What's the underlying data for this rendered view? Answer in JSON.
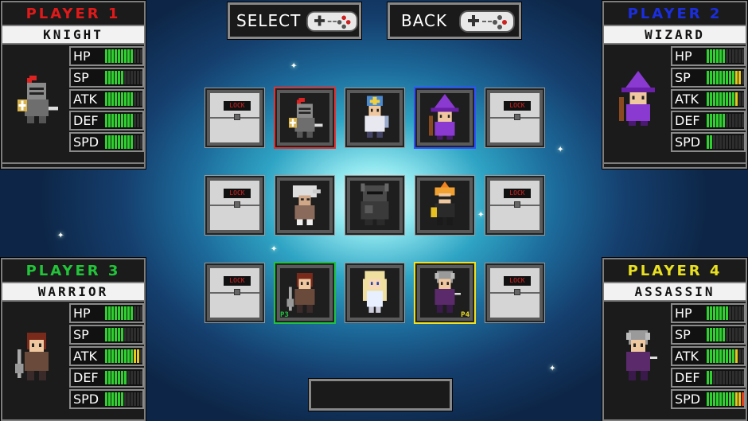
{
  "players": [
    {
      "title": "PLAYER 1",
      "title_color": "#e01a1a",
      "class_name": "KNIGHT",
      "icon": "knight-icon",
      "stats": [
        {
          "label": "HP",
          "value": 9,
          "max": 12
        },
        {
          "label": "SP",
          "value": 6,
          "max": 12
        },
        {
          "label": "ATK",
          "value": 9,
          "max": 12
        },
        {
          "label": "DEF",
          "value": 9,
          "max": 12
        },
        {
          "label": "SPD",
          "value": 9,
          "max": 12
        }
      ]
    },
    {
      "title": "PLAYER 2",
      "title_color": "#1a2ee0",
      "class_name": "WIZARD",
      "icon": "wizard-icon",
      "stats": [
        {
          "label": "HP",
          "value": 6,
          "max": 12
        },
        {
          "label": "SP",
          "value": 11,
          "max": 12
        },
        {
          "label": "ATK",
          "value": 10,
          "max": 12
        },
        {
          "label": "DEF",
          "value": 6,
          "max": 12
        },
        {
          "label": "SPD",
          "value": 2,
          "max": 12
        }
      ]
    },
    {
      "title": "PLAYER 3",
      "title_color": "#22c43a",
      "class_name": "WARRIOR",
      "icon": "warrior-icon",
      "stats": [
        {
          "label": "HP",
          "value": 9,
          "max": 12
        },
        {
          "label": "SP",
          "value": 6,
          "max": 12
        },
        {
          "label": "ATK",
          "value": 11,
          "max": 12
        },
        {
          "label": "DEF",
          "value": 7,
          "max": 12
        },
        {
          "label": "SPD",
          "value": 6,
          "max": 12
        }
      ]
    },
    {
      "title": "PLAYER 4",
      "title_color": "#e8e020",
      "class_name": "ASSASSIN",
      "icon": "assassin-icon",
      "stats": [
        {
          "label": "HP",
          "value": 7,
          "max": 12
        },
        {
          "label": "SP",
          "value": 6,
          "max": 12
        },
        {
          "label": "ATK",
          "value": 10,
          "max": 12
        },
        {
          "label": "DEF",
          "value": 2,
          "max": 12
        },
        {
          "label": "SPD",
          "value": 12,
          "max": 12
        }
      ]
    }
  ],
  "buttons": {
    "select": "SELECT",
    "back": "BACK"
  },
  "lock_label": "LOCK",
  "roster": [
    {
      "icon": "knight-icon",
      "selected_by": "P1"
    },
    {
      "icon": "cleric-icon",
      "selected_by": ""
    },
    {
      "icon": "wizard-icon",
      "selected_by": "P2"
    },
    {
      "icon": "hooded-fighter-icon",
      "selected_by": ""
    },
    {
      "icon": "armored-golem-icon",
      "selected_by": ""
    },
    {
      "icon": "orange-hair-fighter-icon",
      "selected_by": ""
    },
    {
      "icon": "warrior-icon",
      "selected_by": "P3"
    },
    {
      "icon": "blonde-archer-icon",
      "selected_by": ""
    },
    {
      "icon": "assassin-icon",
      "selected_by": "P4"
    }
  ],
  "roster_tags": {
    "p3": "P3",
    "p4": "P4"
  },
  "colors": {
    "p1": "#e03030",
    "p2": "#3050ff",
    "p3": "#20c040",
    "p4": "#f0e020"
  }
}
